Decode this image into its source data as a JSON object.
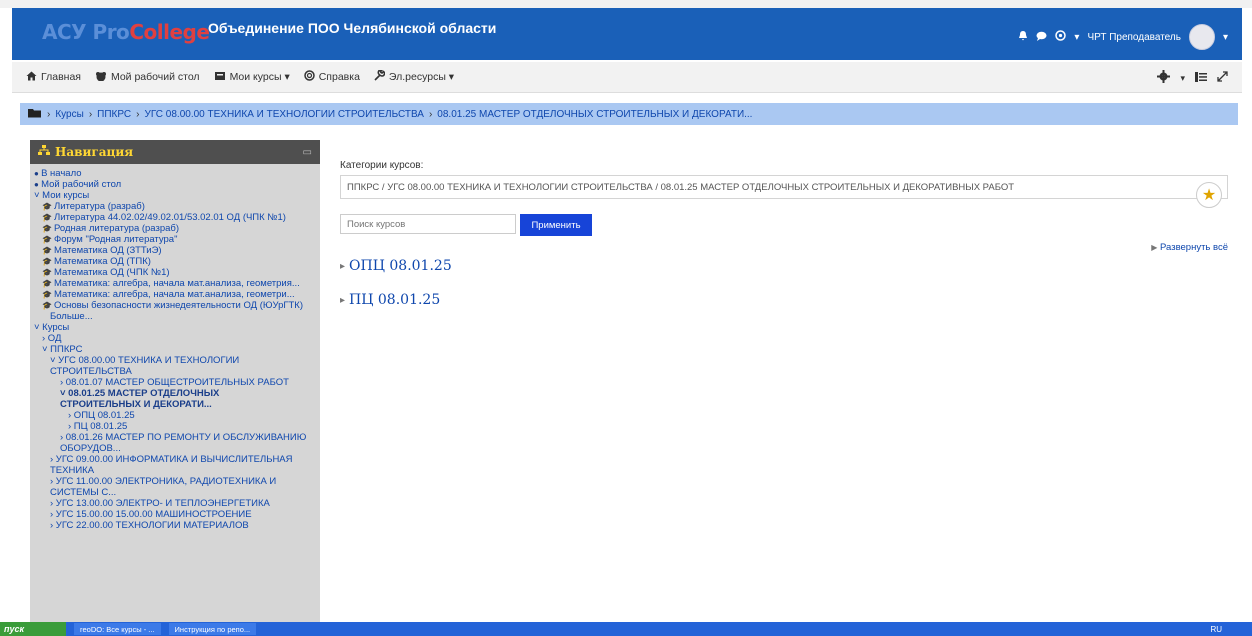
{
  "header": {
    "logo_main": "АСУ Pro",
    "logo_accent": "College",
    "site_title": "Объединение ПОО Челябинской области",
    "user_name": "ЧРТ Преподаватель"
  },
  "menu": {
    "items": [
      {
        "label": "Главная",
        "icon": "home-icon"
      },
      {
        "label": "Мой рабочий стол",
        "icon": "dashboard-icon"
      },
      {
        "label": "Мои курсы ▾",
        "icon": "courses-icon"
      },
      {
        "label": "Справка",
        "icon": "help-icon"
      },
      {
        "label": "Эл.ресурсы ▾",
        "icon": "wrench-icon"
      }
    ]
  },
  "breadcrumb": {
    "items": [
      "Курсы",
      "ППКРС",
      "УГС 08.00.00 ТЕХНИКА И ТЕХНОЛОГИИ СТРОИТЕЛЬСТВА",
      "08.01.25 МАСТЕР ОТДЕЛОЧНЫХ СТРОИТЕЛЬНЫХ И ДЕКОРАТИ..."
    ]
  },
  "navigation": {
    "title": "Навигация",
    "items": [
      {
        "label": "В начало",
        "level": 0
      },
      {
        "label": "Мой рабочий стол",
        "level": 0
      },
      {
        "label": "˅ Мои курсы",
        "level": 0
      },
      {
        "label": "Литература (разраб)",
        "level": 1,
        "course": true
      },
      {
        "label": "Литература 44.02.02/49.02.01/53.02.01 ОД (ЧПК №1)",
        "level": 1,
        "course": true
      },
      {
        "label": "Родная литература (разраб)",
        "level": 1,
        "course": true
      },
      {
        "label": "Форум \"Родная литература\"",
        "level": 1,
        "course": true
      },
      {
        "label": "Математика ОД (ЗТТиЭ)",
        "level": 1,
        "course": true
      },
      {
        "label": "Математика ОД (ТПК)",
        "level": 1,
        "course": true
      },
      {
        "label": "Математика ОД (ЧПК №1)",
        "level": 1,
        "course": true
      },
      {
        "label": "Математика: алгебра, начала мат.анализа, геометрия...",
        "level": 1,
        "course": true
      },
      {
        "label": "Математика: алгебра, начала мат.анализа, геометри...",
        "level": 1,
        "course": true
      },
      {
        "label": "Основы безопасности жизнедеятельности ОД (ЮУрГТК)",
        "level": 1,
        "course": true
      },
      {
        "label": "Больше...",
        "level": 2
      },
      {
        "label": "˅ Курсы",
        "level": 0
      },
      {
        "label": "› ОД",
        "level": 1
      },
      {
        "label": "˅ ППКРС",
        "level": 1
      },
      {
        "label": "˅ УГС 08.00.00 ТЕХНИКА И ТЕХНОЛОГИИ",
        "level": 2
      },
      {
        "label": "СТРОИТЕЛЬСТВА",
        "level": 2
      },
      {
        "label": "› 08.01.07 МАСТЕР ОБЩЕСТРОИТЕЛЬНЫХ РАБОТ",
        "level": 3
      },
      {
        "label": "˅ 08.01.25 МАСТЕР ОТДЕЛОЧНЫХ",
        "level": 3,
        "active": true
      },
      {
        "label": "СТРОИТЕЛЬНЫХ И ДЕКОРАТИ...",
        "level": 3,
        "active": true
      },
      {
        "label": "› ОПЦ 08.01.25",
        "level": 4
      },
      {
        "label": "› ПЦ 08.01.25",
        "level": 4
      },
      {
        "label": "› 08.01.26 МАСТЕР ПО РЕМОНТУ И ОБСЛУЖИВАНИЮ",
        "level": 3
      },
      {
        "label": "ОБОРУДОВ...",
        "level": 3
      },
      {
        "label": "› УГС 09.00.00 ИНФОРМАТИКА И ВЫЧИСЛИТЕЛЬНАЯ",
        "level": 2
      },
      {
        "label": "ТЕХНИКА",
        "level": 2
      },
      {
        "label": "› УГС 11.00.00 ЭЛЕКТРОНИКА, РАДИОТЕХНИКА И",
        "level": 2
      },
      {
        "label": "СИСТЕМЫ С...",
        "level": 2
      },
      {
        "label": "› УГС 13.00.00 ЭЛЕКТРО- И ТЕПЛОЭНЕРГЕТИКА",
        "level": 2
      },
      {
        "label": "› УГС 15.00.00 15.00.00 МАШИНОСТРОЕНИЕ",
        "level": 2
      },
      {
        "label": "› УГС 22.00.00 ТЕХНОЛОГИИ МАТЕРИАЛОВ",
        "level": 2
      }
    ]
  },
  "main": {
    "category_label": "Категории курсов:",
    "category_value": "ППКРС / УГС 08.00.00 ТЕХНИКА И ТЕХНОЛОГИИ СТРОИТЕЛЬСТВА / 08.01.25 МАСТЕР ОТДЕЛОЧНЫХ СТРОИТЕЛЬНЫХ И ДЕКОРАТИВНЫХ РАБОТ",
    "search_placeholder": "Поиск курсов",
    "apply_label": "Применить",
    "expand_all": "Развернуть всё",
    "categories": [
      "ОПЦ 08.01.25",
      "ПЦ 08.01.25"
    ]
  },
  "taskbar": {
    "start": "пуск",
    "tasks": [
      "reoDO: Все курсы - ...",
      "Инструкция по репо..."
    ],
    "lang": "RU"
  },
  "colors": {
    "header": "#1a60b8",
    "breadcrumb": "#aac8f2",
    "link": "#0f47ad",
    "apply": "#1744d8"
  }
}
